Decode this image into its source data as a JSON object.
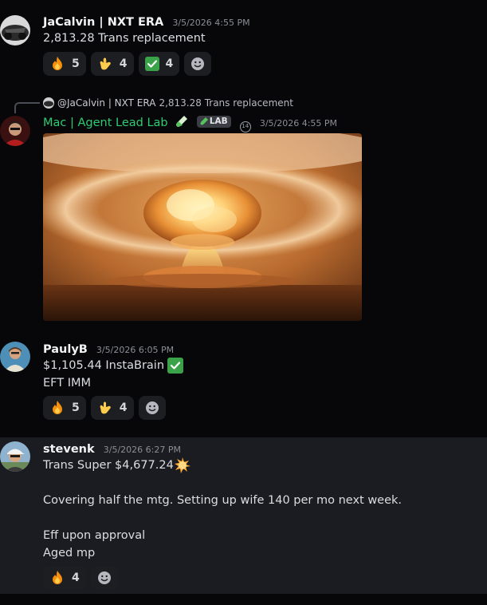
{
  "messages": [
    {
      "username": "JaCalvin | NXT ERA",
      "timestamp": "3/5/2026 4:55 PM",
      "lines": [
        "2,813.28 Trans replacement"
      ],
      "reactions": [
        {
          "emoji": "fire",
          "count": "5"
        },
        {
          "emoji": "call-me-hand",
          "count": "4"
        },
        {
          "emoji": "check-mark-button",
          "count": "4"
        }
      ]
    },
    {
      "reply_to": {
        "username": "@JaCalvin | NXT ERA",
        "text": "2,813.28 Trans replacement"
      },
      "username": "Mac | Agent Lead Lab",
      "name_icon": "test-tube-icon",
      "tag": "LAB",
      "timestamp": "3/5/2026 4:55 PM",
      "attachment": "mushroom-cloud-gif"
    },
    {
      "username": "PaulyB",
      "timestamp": "3/5/2026 6:05 PM",
      "lines": [
        "$1,105.44 InstaBrain",
        "EFT IMM"
      ],
      "reactions": [
        {
          "emoji": "fire",
          "count": "5"
        },
        {
          "emoji": "call-me-hand",
          "count": "4"
        }
      ]
    },
    {
      "username": "stevenk",
      "timestamp": "3/5/2026 6:27 PM",
      "lines": [
        "Trans Super $4,677.24",
        "",
        "Covering half the mtg. Setting up wife 140 per mo next week.",
        "",
        "Eff upon approval",
        "Aged mp"
      ],
      "reactions": [
        {
          "emoji": "fire",
          "count": "4"
        }
      ]
    }
  ],
  "colors": {
    "background": "#070709",
    "highlight": "#1b1c21",
    "reaction_bg": "#1d1e22",
    "role_green": "#2ecc71",
    "timestamp": "#8a8e95"
  }
}
